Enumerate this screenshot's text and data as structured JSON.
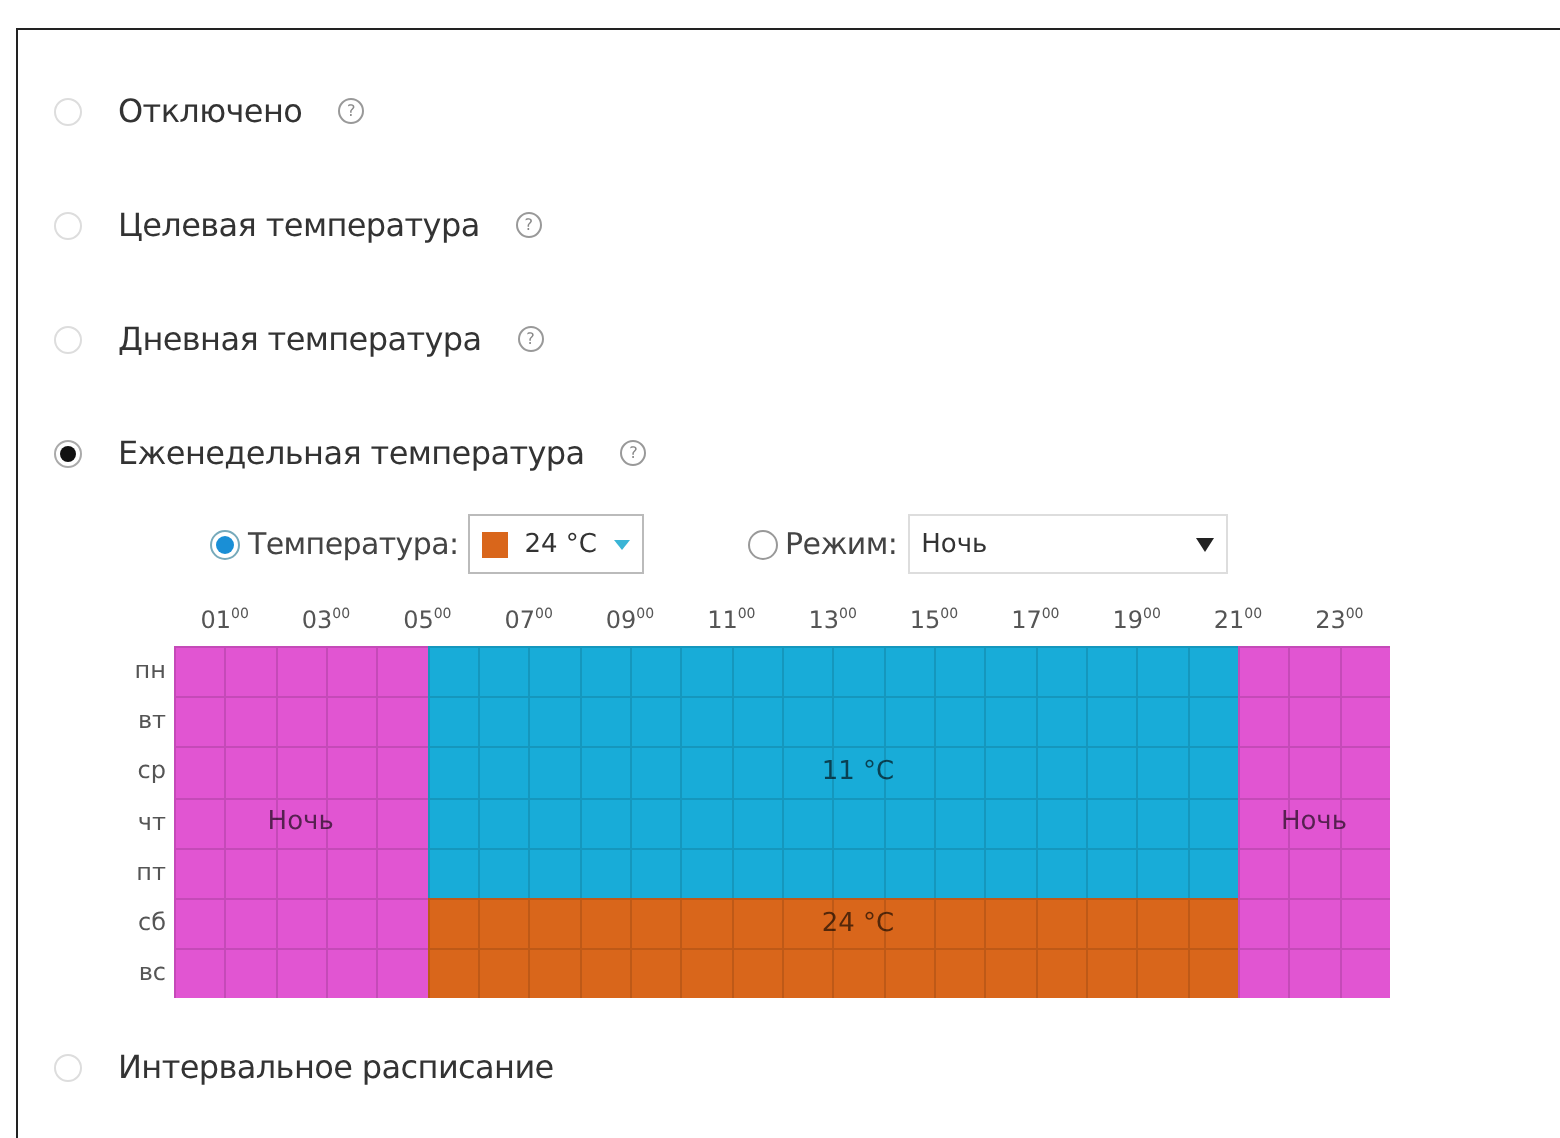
{
  "modes": [
    {
      "label": "Отключено",
      "selected": false,
      "help": "?"
    },
    {
      "label": "Целевая температура",
      "selected": false,
      "help": "?"
    },
    {
      "label": "Дневная температура",
      "selected": false,
      "help": "?"
    },
    {
      "label": "Еженедельная температура",
      "selected": true,
      "help": "?",
      "schedule": {
        "source_options": [
          {
            "kind": "temperature",
            "label": "Температура:",
            "selected": true,
            "value": "24 °C",
            "color": "#d9661b"
          },
          {
            "kind": "mode",
            "label": "Режим:",
            "selected": false,
            "value": "Ночь"
          }
        ],
        "hours": [
          "01$^{00}$",
          "03$^{00}$",
          "05$^{00}$",
          "07$^{00}$",
          "09$^{00}$",
          "11$^{00}$",
          "13$^{00}$",
          "15$^{00}$",
          "17$^{00}$",
          "19$^{00}$",
          "21$^{00}$",
          "23$^{00}$"
        ],
        "days": [
          {
            "label": "пн",
            "cells": [
              {
                "color": "#e155d2"
              },
              {
                "color": "#e155d2"
              },
              {
                "color": "#e155d2"
              },
              {
                "color": "#e155d2"
              },
              {
                "color": "#e155d2"
              },
              {
                "color": "#18acd8"
              },
              {
                "color": "#18acd8"
              },
              {
                "color": "#18acd8"
              },
              {
                "color": "#18acd8"
              },
              {
                "color": "#18acd8"
              },
              {
                "color": "#18acd8"
              },
              {
                "color": "#18acd8"
              },
              {
                "color": "#18acd8"
              },
              {
                "color": "#18acd8"
              },
              {
                "color": "#18acd8"
              },
              {
                "color": "#18acd8"
              },
              {
                "color": "#18acd8"
              },
              {
                "color": "#18acd8"
              },
              {
                "color": "#18acd8"
              },
              {
                "color": "#18acd8"
              },
              {
                "color": "#18acd8"
              },
              {
                "color": "#e155d2"
              },
              {
                "color": "#e155d2"
              },
              {
                "color": "#e155d2"
              }
            ]
          },
          {
            "label": "вт",
            "cells": [
              {
                "color": "#e155d2"
              },
              {
                "color": "#e155d2"
              },
              {
                "color": "#e155d2"
              },
              {
                "color": "#e155d2"
              },
              {
                "color": "#e155d2"
              },
              {
                "color": "#18acd8"
              },
              {
                "color": "#18acd8"
              },
              {
                "color": "#18acd8"
              },
              {
                "color": "#18acd8"
              },
              {
                "color": "#18acd8"
              },
              {
                "color": "#18acd8"
              },
              {
                "color": "#18acd8"
              },
              {
                "color": "#18acd8"
              },
              {
                "color": "#18acd8"
              },
              {
                "color": "#18acd8"
              },
              {
                "color": "#18acd8"
              },
              {
                "color": "#18acd8"
              },
              {
                "color": "#18acd8"
              },
              {
                "color": "#18acd8"
              },
              {
                "color": "#18acd8"
              },
              {
                "color": "#18acd8"
              },
              {
                "color": "#e155d2"
              },
              {
                "color": "#e155d2"
              },
              {
                "color": "#e155d2"
              }
            ]
          },
          {
            "label": "ср",
            "cells": [
              {
                "color": "#e155d2"
              },
              {
                "color": "#e155d2"
              },
              {
                "color": "#e155d2"
              },
              {
                "color": "#e155d2"
              },
              {
                "color": "#e155d2"
              },
              {
                "color": "#18acd8"
              },
              {
                "color": "#18acd8"
              },
              {
                "color": "#18acd8"
              },
              {
                "color": "#18acd8"
              },
              {
                "color": "#18acd8"
              },
              {
                "color": "#18acd8"
              },
              {
                "color": "#18acd8"
              },
              {
                "color": "#18acd8"
              },
              {
                "color": "#18acd8",
                "label": "11 °C"
              },
              {
                "color": "#18acd8"
              },
              {
                "color": "#18acd8"
              },
              {
                "color": "#18acd8"
              },
              {
                "color": "#18acd8"
              },
              {
                "color": "#18acd8"
              },
              {
                "color": "#18acd8"
              },
              {
                "color": "#18acd8"
              },
              {
                "color": "#e155d2"
              },
              {
                "color": "#e155d2"
              },
              {
                "color": "#e155d2"
              }
            ]
          },
          {
            "label": "чт",
            "cells": [
              {
                "color": "#e155d2"
              },
              {
                "color": "#e155d2"
              },
              {
                "color": "#e155d2",
                "label": "Ночь"
              },
              {
                "color": "#e155d2"
              },
              {
                "color": "#e155d2"
              },
              {
                "color": "#18acd8"
              },
              {
                "color": "#18acd8"
              },
              {
                "color": "#18acd8"
              },
              {
                "color": "#18acd8"
              },
              {
                "color": "#18acd8"
              },
              {
                "color": "#18acd8"
              },
              {
                "color": "#18acd8"
              },
              {
                "color": "#18acd8"
              },
              {
                "color": "#18acd8"
              },
              {
                "color": "#18acd8"
              },
              {
                "color": "#18acd8"
              },
              {
                "color": "#18acd8"
              },
              {
                "color": "#18acd8"
              },
              {
                "color": "#18acd8"
              },
              {
                "color": "#18acd8"
              },
              {
                "color": "#18acd8"
              },
              {
                "color": "#e155d2"
              },
              {
                "color": "#e155d2",
                "label": "Ночь"
              },
              {
                "color": "#e155d2"
              }
            ]
          },
          {
            "label": "пт",
            "cells": [
              {
                "color": "#e155d2"
              },
              {
                "color": "#e155d2"
              },
              {
                "color": "#e155d2"
              },
              {
                "color": "#e155d2"
              },
              {
                "color": "#e155d2"
              },
              {
                "color": "#18acd8"
              },
              {
                "color": "#18acd8"
              },
              {
                "color": "#18acd8"
              },
              {
                "color": "#18acd8"
              },
              {
                "color": "#18acd8"
              },
              {
                "color": "#18acd8"
              },
              {
                "color": "#18acd8"
              },
              {
                "color": "#18acd8"
              },
              {
                "color": "#18acd8"
              },
              {
                "color": "#18acd8"
              },
              {
                "color": "#18acd8"
              },
              {
                "color": "#18acd8"
              },
              {
                "color": "#18acd8"
              },
              {
                "color": "#18acd8"
              },
              {
                "color": "#18acd8"
              },
              {
                "color": "#18acd8"
              },
              {
                "color": "#e155d2"
              },
              {
                "color": "#e155d2"
              },
              {
                "color": "#e155d2"
              }
            ]
          },
          {
            "label": "сб",
            "cells": [
              {
                "color": "#e155d2"
              },
              {
                "color": "#e155d2"
              },
              {
                "color": "#e155d2"
              },
              {
                "color": "#e155d2"
              },
              {
                "color": "#e155d2"
              },
              {
                "color": "#d9661b"
              },
              {
                "color": "#d9661b"
              },
              {
                "color": "#d9661b"
              },
              {
                "color": "#d9661b"
              },
              {
                "color": "#d9661b"
              },
              {
                "color": "#d9661b"
              },
              {
                "color": "#d9661b"
              },
              {
                "color": "#d9661b"
              },
              {
                "color": "#d9661b",
                "label": "24 °C"
              },
              {
                "color": "#d9661b"
              },
              {
                "color": "#d9661b"
              },
              {
                "color": "#d9661b"
              },
              {
                "color": "#d9661b"
              },
              {
                "color": "#d9661b"
              },
              {
                "color": "#d9661b"
              },
              {
                "color": "#d9661b"
              },
              {
                "color": "#e155d2"
              },
              {
                "color": "#e155d2"
              },
              {
                "color": "#e155d2"
              }
            ]
          },
          {
            "label": "вс",
            "cells": [
              {
                "color": "#e155d2"
              },
              {
                "color": "#e155d2"
              },
              {
                "color": "#e155d2"
              },
              {
                "color": "#e155d2"
              },
              {
                "color": "#e155d2"
              },
              {
                "color": "#d9661b"
              },
              {
                "color": "#d9661b"
              },
              {
                "color": "#d9661b"
              },
              {
                "color": "#d9661b"
              },
              {
                "color": "#d9661b"
              },
              {
                "color": "#d9661b"
              },
              {
                "color": "#d9661b"
              },
              {
                "color": "#d9661b"
              },
              {
                "color": "#d9661b"
              },
              {
                "color": "#d9661b"
              },
              {
                "color": "#d9661b"
              },
              {
                "color": "#d9661b"
              },
              {
                "color": "#d9661b"
              },
              {
                "color": "#d9661b"
              },
              {
                "color": "#d9661b"
              },
              {
                "color": "#d9661b"
              },
              {
                "color": "#e155d2"
              },
              {
                "color": "#e155d2"
              },
              {
                "color": "#e155d2"
              }
            ]
          }
        ]
      }
    },
    {
      "label": "Интервальное расписание",
      "selected": false
    }
  ]
}
